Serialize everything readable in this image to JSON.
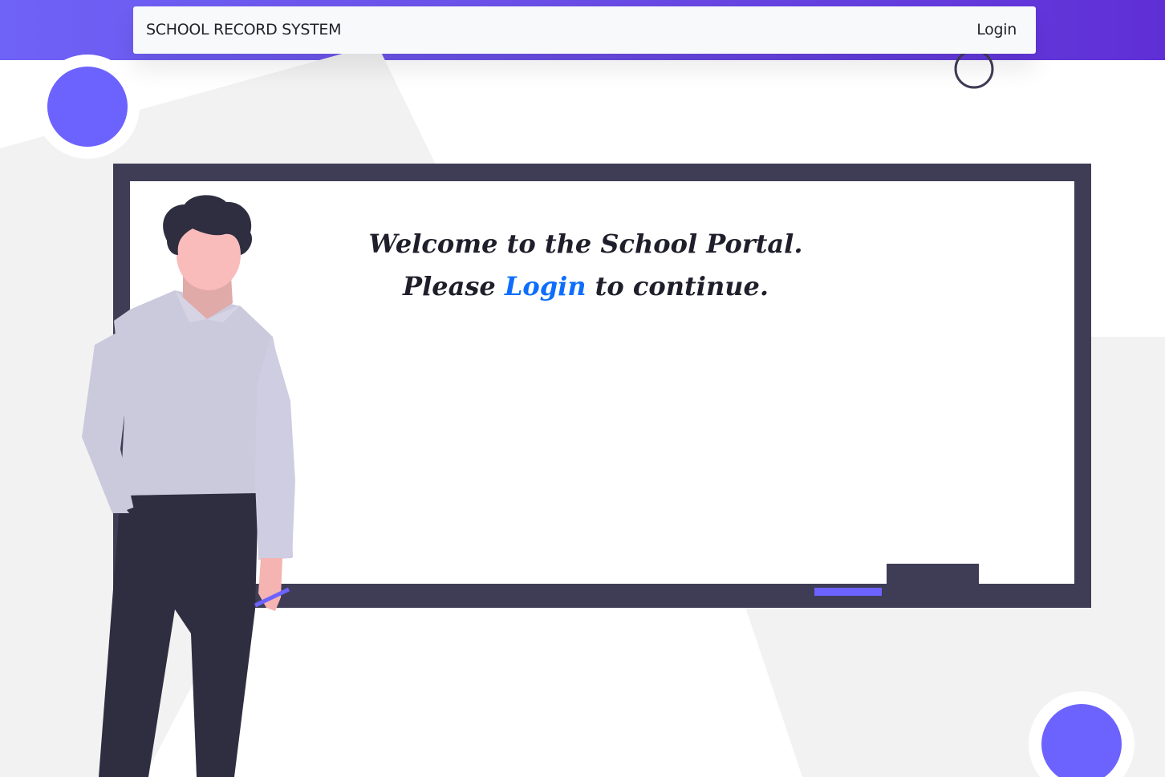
{
  "header": {
    "brand": "SCHOOL RECORD SYSTEM",
    "login_label": "Login"
  },
  "hero": {
    "line1": "Welcome to the School Portal.",
    "line2_before": "Please",
    "line2_link": "Login",
    "line2_after": "to continue."
  },
  "colors": {
    "band_start": "#6f62f6",
    "band_end": "#5f2fd6",
    "accent_circle": "#6c63ff",
    "board_frame": "#3f3d56",
    "link": "#0d6efd"
  }
}
